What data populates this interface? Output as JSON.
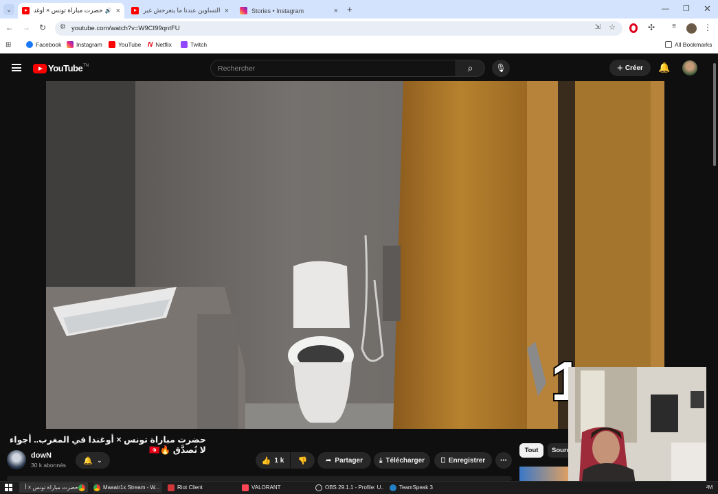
{
  "browser": {
    "tabs": [
      {
        "title": "حضرت مباراة تونس × أوغندا ا",
        "icon": "youtube-favicon"
      },
      {
        "title": "التساوين عندنا ما يتعرحش غير ك",
        "icon": "youtube-favicon"
      },
      {
        "title": "Stories • Instagram",
        "icon": "instagram-favicon"
      }
    ],
    "new_tab": "+",
    "url": "youtube.com/watch?v=W9CI99qntFU",
    "bookmarks": [
      "Facebook",
      "Instagram",
      "YouTube",
      "Netflix",
      "Twitch"
    ],
    "all_bookmarks": "All Bookmarks"
  },
  "youtube": {
    "logo_text": "YouTube",
    "logo_country": "TN",
    "search_placeholder": "Rechercher",
    "create_label": "Créer"
  },
  "video": {
    "overlay_number": "1",
    "title": "حضرت مباراة تونس × أوغندا في المغرب.. أجواء لا تُصدَّق 🔥🇹🇳",
    "channel_name": "dowN",
    "subscribers": "30 k abonnés",
    "like_count": "1 k",
    "share_label": "Partager",
    "download_label": "Télécharger",
    "save_label": "Enregistrer",
    "more_label": "⋯",
    "chips": [
      "Tout",
      "Sourc"
    ]
  },
  "taskbar": {
    "items": [
      "حضرت مباراة تونس × أ",
      "Maaatr1x Stream - W...",
      "Riot Client",
      "VALORANT",
      "OBS 29.1.1 - Profile: U...",
      "TeamSpeak 3"
    ],
    "clock_fragment": "²M"
  },
  "colors": {
    "youtube_red": "#ff0000",
    "bg_dark": "#0f0f0f",
    "chrome_tabbar": "#d3e3fd"
  }
}
